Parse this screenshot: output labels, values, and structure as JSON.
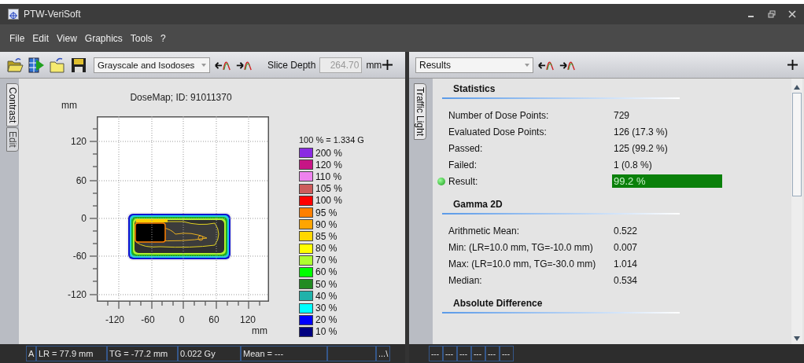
{
  "window": {
    "title": "PTW-VeriSoft"
  },
  "menu": [
    "File",
    "Edit",
    "View",
    "Graphics",
    "Tools",
    "?"
  ],
  "left_toolbar": {
    "display_mode": "Grayscale and Isodoses",
    "slice_depth_label": "Slice Depth",
    "slice_depth": "264.70",
    "unit": "mm"
  },
  "left_tabs": [
    {
      "label": "Contrast",
      "selected": true
    },
    {
      "label": "Edit",
      "selected": false
    }
  ],
  "dose_map": {
    "title": "DoseMap; ID: 91011370",
    "y_unit": "mm",
    "x_unit": "mm",
    "y_ticks": [
      "120",
      "60",
      "0",
      "-60",
      "-120"
    ],
    "x_ticks": [
      "-120",
      "-60",
      "0",
      "60",
      "120"
    ]
  },
  "legend": {
    "header": "100 % = 1.334 G",
    "items": [
      {
        "label": "200 %",
        "color": "#8a2be2"
      },
      {
        "label": "120 %",
        "color": "#c71585"
      },
      {
        "label": "110 %",
        "color": "#ee82ee"
      },
      {
        "label": "105 %",
        "color": "#cd5c5c"
      },
      {
        "label": "100 %",
        "color": "#ff0000"
      },
      {
        "label": "95 %",
        "color": "#ff7f00"
      },
      {
        "label": "90 %",
        "color": "#ffa500"
      },
      {
        "label": "85 %",
        "color": "#ffd700"
      },
      {
        "label": "80 %",
        "color": "#ffff00"
      },
      {
        "label": "70 %",
        "color": "#adff2f"
      },
      {
        "label": "60 %",
        "color": "#00ff00"
      },
      {
        "label": "50 %",
        "color": "#228b22"
      },
      {
        "label": "40 %",
        "color": "#20b2aa"
      },
      {
        "label": "30 %",
        "color": "#00ffff"
      },
      {
        "label": "20 %",
        "color": "#0000ff"
      },
      {
        "label": "10 %",
        "color": "#000080"
      }
    ]
  },
  "left_status": [
    "A",
    "LR = 77.9 mm",
    "TG = -77.2 mm",
    "0.022 Gy",
    "Mean = ---"
  ],
  "left_status_end": "...\\",
  "right_toolbar": {
    "view": "Results"
  },
  "right_tabs": [
    {
      "label": "Traffic Light",
      "selected": true
    }
  ],
  "sections": [
    {
      "title": "Statistics",
      "rows": [
        {
          "kind": "plain",
          "label": "Number of Dose Points:",
          "value": "729"
        },
        {
          "kind": "plain",
          "label": "Evaluated Dose Points:",
          "value": "126 (17.3 %)"
        },
        {
          "kind": "plain",
          "label": "Passed:",
          "value": "125 (99.2 %)"
        },
        {
          "kind": "plain",
          "label": "Failed:",
          "value": "1 (0.8 %)"
        },
        {
          "kind": "result",
          "label": "Result:",
          "value": "99.2 %"
        }
      ]
    },
    {
      "title": "Gamma 2D",
      "rows": [
        {
          "kind": "plain",
          "label": "Arithmetic Mean:",
          "value": "0.522"
        },
        {
          "kind": "plain",
          "label": "Min: (LR=10.0 mm, TG=-10.0 mm)",
          "value": "0.007"
        },
        {
          "kind": "plain",
          "label": "Max: (LR=10.0 mm, TG=-30.0 mm)",
          "value": "1.014"
        },
        {
          "kind": "plain",
          "label": "Median:",
          "value": "0.534"
        }
      ]
    },
    {
      "title": "Absolute Difference"
    }
  ],
  "right_status": [
    "---",
    "---",
    "---",
    "---",
    "---",
    "---"
  ]
}
